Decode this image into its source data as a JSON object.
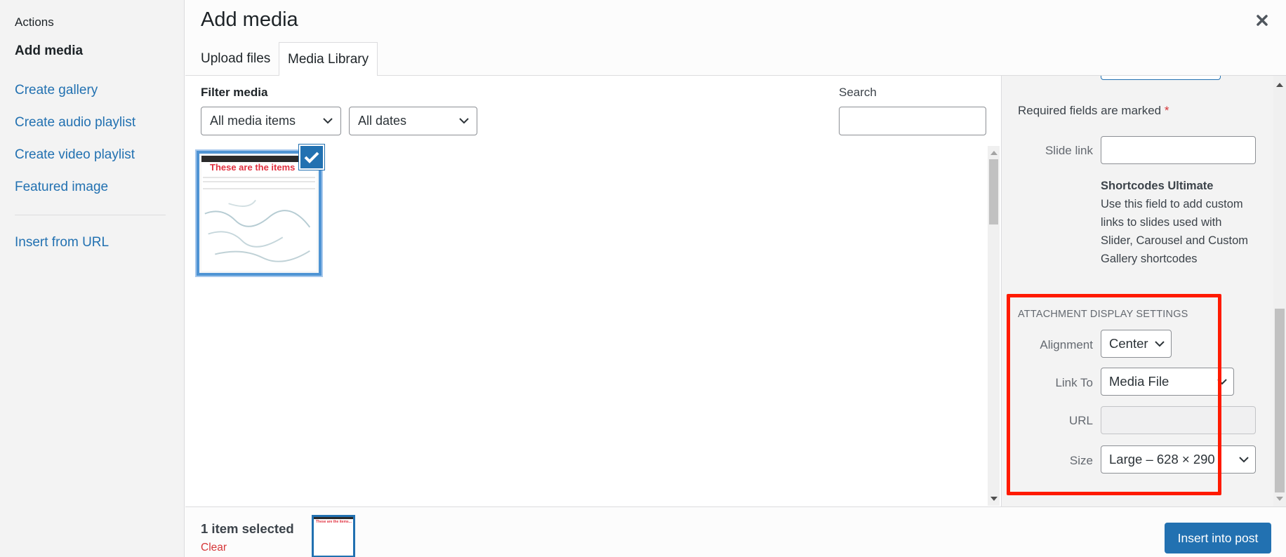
{
  "menu": {
    "heading": "Actions",
    "items": [
      {
        "label": "Add media",
        "active": true
      },
      {
        "label": "Create gallery"
      },
      {
        "label": "Create audio playlist"
      },
      {
        "label": "Create video playlist"
      },
      {
        "label": "Featured image"
      },
      {
        "label": "Insert from URL"
      }
    ]
  },
  "header": {
    "title": "Add media",
    "close_icon": "close-x-icon",
    "tabs": [
      {
        "label": "Upload files",
        "active": false
      },
      {
        "label": "Media Library",
        "active": true
      }
    ]
  },
  "filters": {
    "label": "Filter media",
    "type_select": "All media items",
    "date_select": "All dates",
    "search_label": "Search",
    "search_value": ""
  },
  "library": {
    "items": [
      {
        "thumb_headline": "These are the items",
        "selected": true,
        "check_icon": "checkmark-icon"
      }
    ]
  },
  "details": {
    "required_note": "Required fields are marked",
    "required_marker": "*",
    "slide_link_label": "Slide link",
    "slide_link_value": "",
    "plugin_name": "Shortcodes Ultimate",
    "plugin_desc": "Use this field to add custom links to slides used with Slider, Carousel and Custom Gallery shortcodes"
  },
  "display_settings": {
    "title": "Attachment Display Settings",
    "alignment_label": "Alignment",
    "alignment_value": "Center",
    "link_to_label": "Link To",
    "link_to_value": "Media File",
    "url_label": "URL",
    "url_value": "",
    "size_label": "Size",
    "size_value": "Large – 628 × 290",
    "highlight_color": "#ff1a00"
  },
  "toolbar": {
    "selection_count": "1 item selected",
    "clear_label": "Clear",
    "mini_thumb_headline": "These are the items...",
    "insert_label": "Insert into post"
  },
  "colors": {
    "accent": "#2271b1",
    "danger": "#d63638",
    "sidebar_bg": "#f3f3f3"
  }
}
